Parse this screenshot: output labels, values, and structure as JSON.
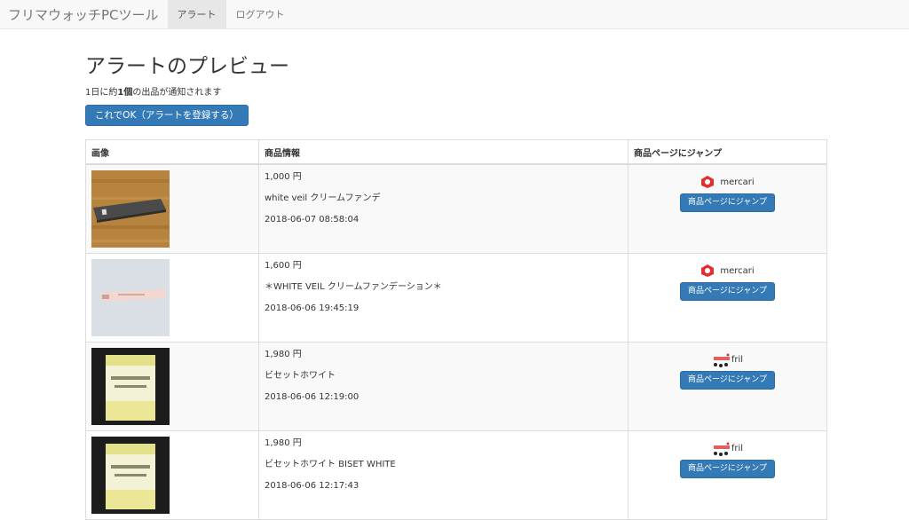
{
  "nav": {
    "brand": "フリマウォッチPCツール",
    "items": [
      {
        "label": "アラート",
        "active": true
      },
      {
        "label": "ログアウト",
        "active": false
      }
    ]
  },
  "page": {
    "title": "アラートのプレビュー",
    "summary_prefix": "1日に約",
    "summary_count": "1個",
    "summary_suffix": "の出品が通知されます",
    "confirm_button": "これでOK（アラートを登録する）"
  },
  "table": {
    "headers": [
      "画像",
      "商品情報",
      "商品ページにジャンプ"
    ],
    "jump_label": "商品ページにジャンプ",
    "rows": [
      {
        "price": "1,000 円",
        "name": "white veil クリームファンデ",
        "date": "2018-06-07 08:58:04",
        "site": "mercari",
        "site_icon": "mercari-icon"
      },
      {
        "price": "1,600 円",
        "name": "＊WHITE VEIL クリームファンデーション＊",
        "date": "2018-06-06 19:45:19",
        "site": "mercari",
        "site_icon": "mercari-icon"
      },
      {
        "price": "1,980 円",
        "name": "ビセットホワイト",
        "date": "2018-06-06 12:19:00",
        "site": "fril",
        "site_icon": "fril-icon"
      },
      {
        "price": "1,980 円",
        "name": "ビセットホワイト BISET WHITE",
        "date": "2018-06-06 12:17:43",
        "site": "fril",
        "site_icon": "fril-icon"
      }
    ]
  },
  "colors": {
    "primary": "#337ab7",
    "navbar_bg": "#f8f8f8",
    "stripe": "#f9f9f9"
  }
}
